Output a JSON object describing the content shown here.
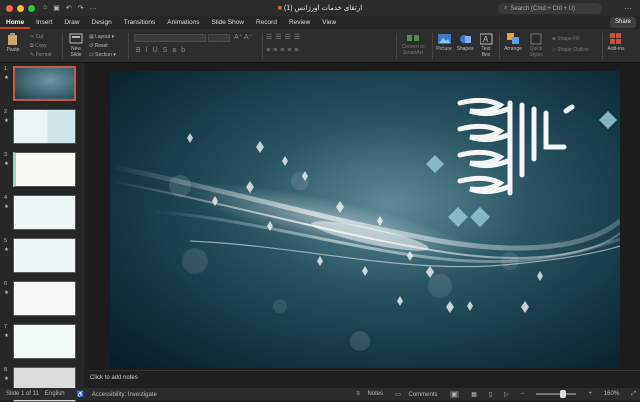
{
  "window": {
    "title": "ارتقای خدمات اورژانس (1)",
    "search_placeholder": "Search (Cmd + Ctrl + U)"
  },
  "tabs": [
    {
      "label": "Home",
      "active": true
    },
    {
      "label": "Insert"
    },
    {
      "label": "Draw"
    },
    {
      "label": "Design"
    },
    {
      "label": "Transitions"
    },
    {
      "label": "Animations"
    },
    {
      "label": "Slide Show"
    },
    {
      "label": "Record"
    },
    {
      "label": "Review"
    },
    {
      "label": "View"
    }
  ],
  "share_label": "Share",
  "ribbon": {
    "paste": "Paste",
    "cut": "Cut",
    "copy": "Copy",
    "format": "Format",
    "new_slide": "New Slide",
    "layout": "Layout",
    "reset": "Reset",
    "section": "Section",
    "convert": "Convert to SmartArt",
    "picture": "Picture",
    "shapes": "Shapes",
    "textbox": "Text Box",
    "arrange": "Arrange",
    "quick_styles": "Quick Styles",
    "shape_fill": "Shape Fill",
    "shape_outline": "Shape Outline",
    "addins": "Add-ins"
  },
  "thumbnails": [
    {
      "num": "1",
      "selected": true
    },
    {
      "num": "2"
    },
    {
      "num": "3"
    },
    {
      "num": "4"
    },
    {
      "num": "5"
    },
    {
      "num": "6"
    },
    {
      "num": "7"
    },
    {
      "num": "8"
    }
  ],
  "notes_placeholder": "Click to add notes",
  "status": {
    "slide": "Slide 1 of 11",
    "language": "English",
    "accessibility": "Accessibility: Investigate",
    "notes": "Notes",
    "comments": "Comments",
    "zoom": "160%"
  },
  "colors": {
    "accent": "#c43e1c",
    "slide_bg": "#2b5563"
  }
}
